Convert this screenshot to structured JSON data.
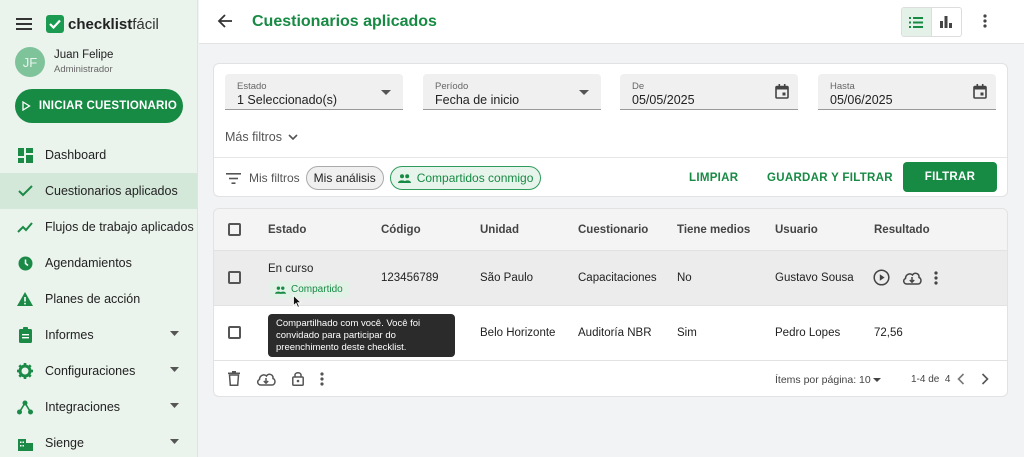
{
  "app": {
    "brand_bold": "checklist",
    "brand_regular": "fácil"
  },
  "user": {
    "initials": "JF",
    "name": "Juan Felipe",
    "role": "Administrador"
  },
  "sidebar": {
    "start_button": "INICIAR CUESTIONARIO",
    "items": [
      {
        "label": "Dashboard",
        "icon": "dashboard-icon"
      },
      {
        "label": "Cuestionarios aplicados",
        "icon": "check-icon",
        "active": true
      },
      {
        "label": "Flujos de trabajo aplicados",
        "icon": "trend-icon"
      },
      {
        "label": "Agendamientos",
        "icon": "clock-icon"
      },
      {
        "label": "Planes de acción",
        "icon": "warning-icon"
      },
      {
        "label": "Informes",
        "icon": "clipboard-icon",
        "expandable": true
      },
      {
        "label": "Configuraciones",
        "icon": "gear-icon",
        "expandable": true
      },
      {
        "label": "Integraciones",
        "icon": "integration-icon",
        "expandable": true
      },
      {
        "label": "Sienge",
        "icon": "building-icon",
        "expandable": true
      }
    ]
  },
  "header": {
    "title": "Cuestionarios aplicados"
  },
  "filters": {
    "estado": {
      "label": "Estado",
      "value": "1 Seleccionado(s)"
    },
    "periodo": {
      "label": "Período",
      "value": "Fecha de inicio"
    },
    "de": {
      "label": "De",
      "value": "05/05/2025"
    },
    "hasta": {
      "label": "Hasta",
      "value": "05/06/2025"
    },
    "more_filters": "Más filtros",
    "my_filters_label": "Mis filtros",
    "chip_my_analysis": "Mis análisis",
    "chip_shared": "Compartidos conmigo",
    "clear": "LIMPIAR",
    "save_and_filter": "GUARDAR Y FILTRAR",
    "filter": "FILTRAR"
  },
  "table": {
    "columns": [
      "Estado",
      "Código",
      "Unidad",
      "Cuestionario",
      "Tiene medios",
      "Usuario",
      "Resultado"
    ],
    "rows": [
      {
        "estado": "En curso",
        "badge": "Compartido",
        "codigo": "123456789",
        "unidad": "São Paulo",
        "cuestionario": "Capacitaciones",
        "medios": "No",
        "usuario": "Gustavo Sousa",
        "resultado": ""
      },
      {
        "estado": "",
        "badge": "",
        "codigo": "",
        "unidad": "Belo Horizonte",
        "cuestionario": "Auditoría NBR",
        "medios": "Sim",
        "usuario": "Pedro Lopes",
        "resultado": "72,56"
      }
    ],
    "pager": {
      "items_per_page_label": "Ítems por página: 10",
      "range": "1-4 de",
      "total": "4"
    }
  },
  "tooltip": {
    "text": "Compartilhado com você. Você foi convidado para participar do preenchimento deste checklist."
  },
  "colors": {
    "brand": "#178a44",
    "sidebar_bg": "#eaf3ec"
  }
}
